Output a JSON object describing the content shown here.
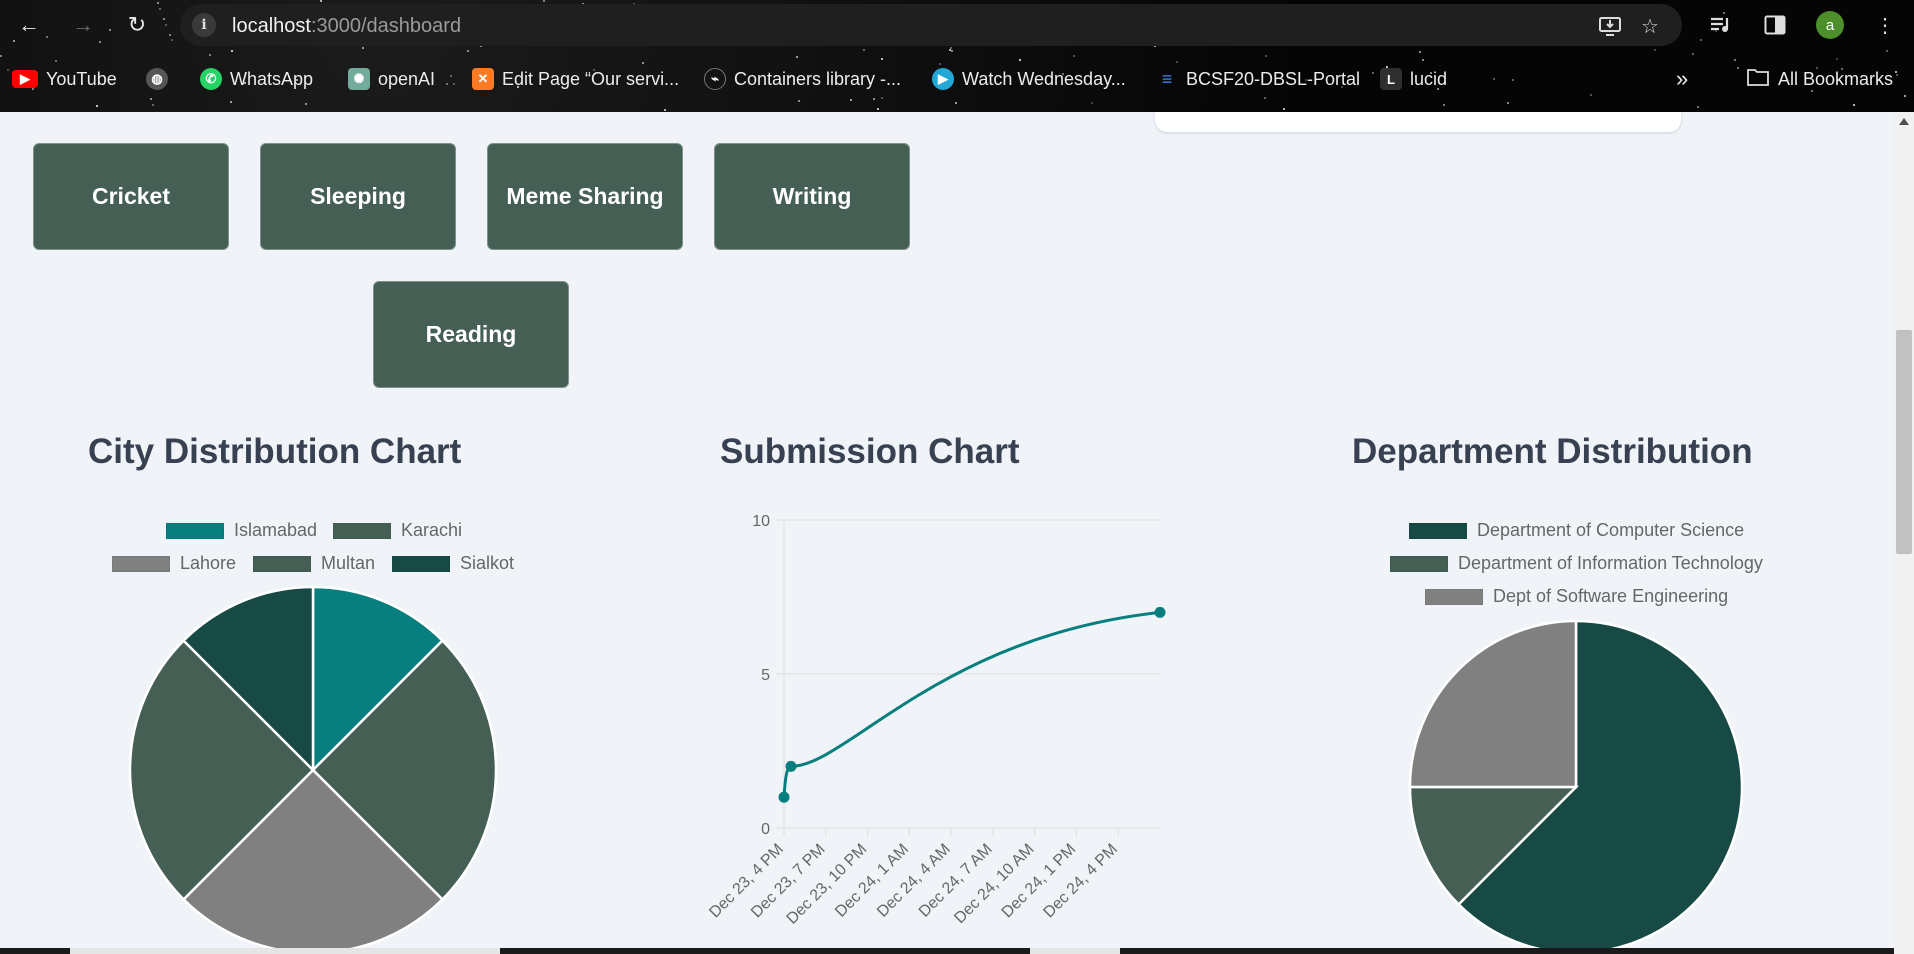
{
  "browser": {
    "url_host": "localhost",
    "url_rest": ":3000/dashboard",
    "avatar_letter": "a",
    "bookmarks": [
      {
        "label": "YouTube",
        "icon": "youtube-icon",
        "color": "#ff0000"
      },
      {
        "label": "",
        "icon": "globe-icon",
        "color": "#6b6b6b"
      },
      {
        "label": "WhatsApp",
        "icon": "whatsapp-icon",
        "color": "#25d366"
      },
      {
        "label": "openAI",
        "icon": "openai-icon",
        "color": "#74aa9c"
      },
      {
        "label": "Edit Page “Our servi...",
        "icon": "xampp-icon",
        "color": "#fb7a24"
      },
      {
        "label": "Containers library -...",
        "icon": "containers-icon",
        "color": "#333333"
      },
      {
        "label": "Watch Wednesday...",
        "icon": "play-icon",
        "color": "#22a7d6"
      },
      {
        "label": "BCSF20-DBSL-Portal",
        "icon": "database-icon",
        "color": "#3b82f6"
      },
      {
        "label": "lucid",
        "icon": "lucid-icon",
        "color": "#2f2f2f"
      }
    ],
    "all_bookmarks_label": "All Bookmarks"
  },
  "hobbies": {
    "items": [
      "Cricket",
      "Sleeping",
      "Meme Sharing",
      "Writing",
      "Reading"
    ]
  },
  "charts": {
    "city": {
      "title": "City Distribution Chart"
    },
    "submission": {
      "title": "Submission Chart"
    },
    "department": {
      "title": "Department Distribution"
    }
  },
  "chart_data": [
    {
      "type": "pie",
      "title": "City Distribution Chart",
      "labels": [
        "Islamabad",
        "Karachi",
        "Lahore",
        "Multan",
        "Sialkot"
      ],
      "values": [
        1,
        2,
        2,
        2,
        1
      ],
      "colors": [
        "#087f7f",
        "#455f55",
        "#808080",
        "#455f55",
        "#184a45"
      ],
      "legend": "top"
    },
    {
      "type": "line",
      "title": "Submission Chart",
      "x": [
        "Dec 23, 4 PM",
        "Dec 23, 4:30 PM",
        "Dec 24, 7 PM"
      ],
      "y": [
        1,
        2,
        7
      ],
      "color": "#087f7f",
      "x_tick_labels": [
        "Dec 23, 4 PM",
        "Dec 23, 7 PM",
        "Dec 23, 10 PM",
        "Dec 24, 1 AM",
        "Dec 24, 4 AM",
        "Dec 24, 7 AM",
        "Dec 24, 10 AM",
        "Dec 24, 1 PM",
        "Dec 24, 4 PM"
      ],
      "y_ticks": [
        "0",
        "5",
        "10"
      ],
      "ylim": [
        0,
        10
      ],
      "grid": true
    },
    {
      "type": "pie",
      "title": "Department Distribution",
      "labels": [
        "Department of Computer Science",
        "Department of Information Technology",
        "Dept of Software Engineering"
      ],
      "values": [
        5,
        1,
        2
      ],
      "colors": [
        "#184a45",
        "#455f55",
        "#808080"
      ],
      "legend": "top"
    }
  ]
}
